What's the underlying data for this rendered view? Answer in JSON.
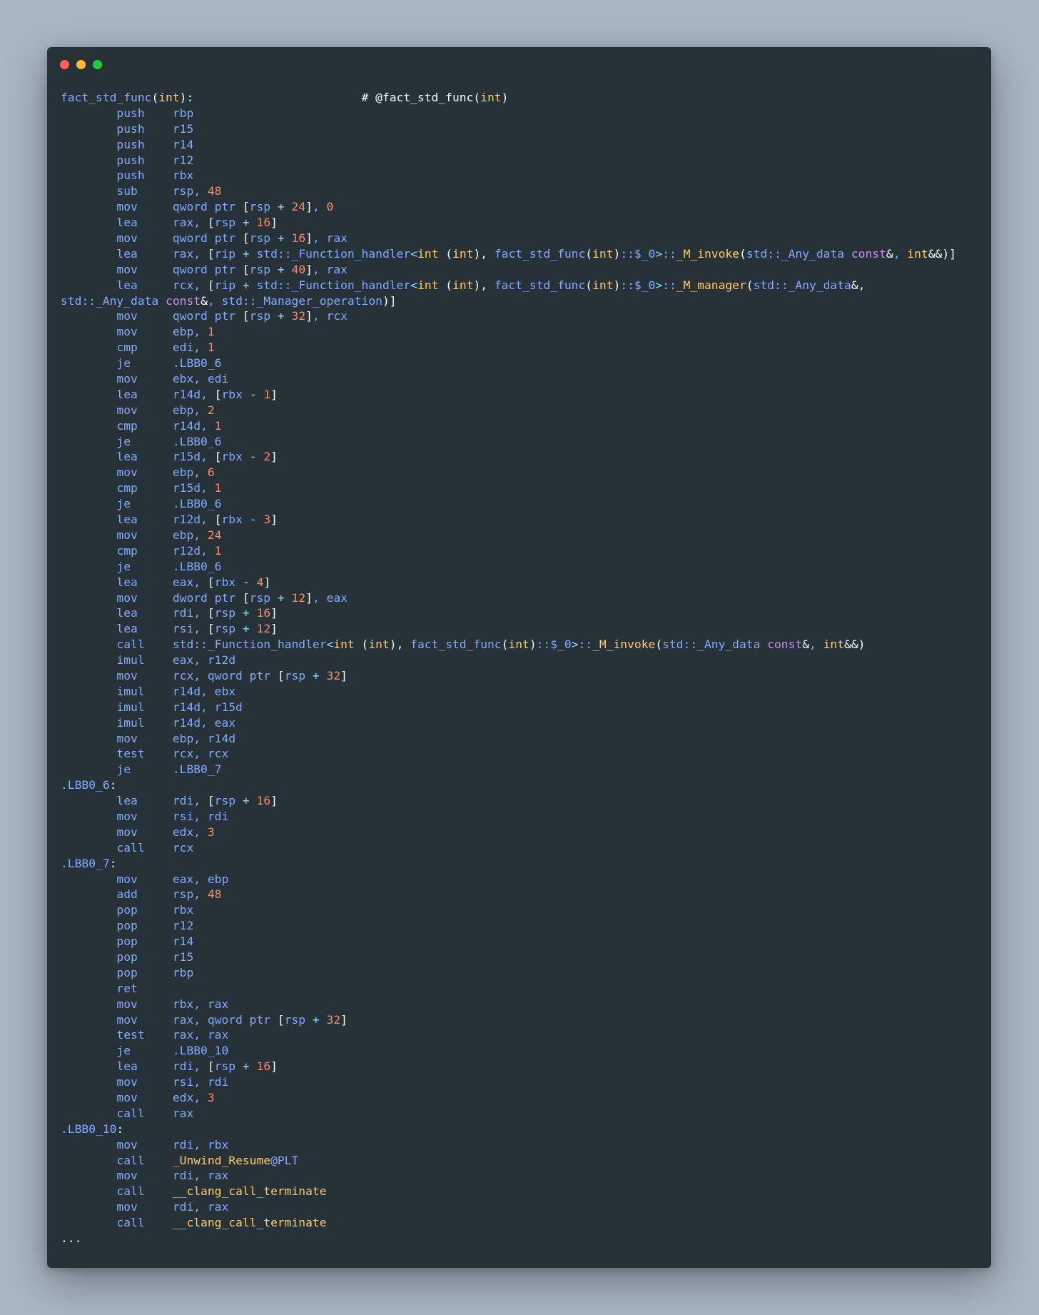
{
  "window": {
    "traffic_lights": [
      {
        "name": "close",
        "color": "#ff5f56"
      },
      {
        "name": "minimize",
        "color": "#ffbd2e"
      },
      {
        "name": "zoom",
        "color": "#27c93f"
      }
    ]
  },
  "code": {
    "lines": [
      [
        [
          "f",
          "fact_std_func"
        ],
        [
          "p",
          "("
        ],
        [
          "k",
          "int"
        ],
        [
          "p",
          "):"
        ],
        [
          "c",
          "                        # @fact_std_func("
        ],
        [
          "k",
          "int"
        ],
        [
          "c",
          ")"
        ]
      ],
      [
        [
          "a",
          "        push    rbp"
        ]
      ],
      [
        [
          "a",
          "        push    r15"
        ]
      ],
      [
        [
          "a",
          "        push    r14"
        ]
      ],
      [
        [
          "a",
          "        push    r12"
        ]
      ],
      [
        [
          "a",
          "        push    rbx"
        ]
      ],
      [
        [
          "a",
          "        sub     rsp, "
        ],
        [
          "n",
          "48"
        ]
      ],
      [
        [
          "a",
          "        mov     qword ptr "
        ],
        [
          "p",
          "["
        ],
        [
          "a",
          "rsp "
        ],
        [
          "o",
          "+"
        ],
        [
          "a",
          " "
        ],
        [
          "n",
          "24"
        ],
        [
          "p",
          "]"
        ],
        [
          "a",
          ", "
        ],
        [
          "n",
          "0"
        ]
      ],
      [
        [
          "a",
          "        lea     rax, "
        ],
        [
          "p",
          "["
        ],
        [
          "a",
          "rsp "
        ],
        [
          "o",
          "+"
        ],
        [
          "a",
          " "
        ],
        [
          "n",
          "16"
        ],
        [
          "p",
          "]"
        ]
      ],
      [
        [
          "a",
          "        mov     qword ptr "
        ],
        [
          "p",
          "["
        ],
        [
          "a",
          "rsp "
        ],
        [
          "o",
          "+"
        ],
        [
          "a",
          " "
        ],
        [
          "n",
          "16"
        ],
        [
          "p",
          "]"
        ],
        [
          "a",
          ", rax"
        ]
      ],
      [
        [
          "a",
          "        lea     rax, "
        ],
        [
          "p",
          "["
        ],
        [
          "a",
          "rip "
        ],
        [
          "o",
          "+"
        ],
        [
          "a",
          " std::_Function_handler"
        ],
        [
          "o",
          "<"
        ],
        [
          "k",
          "int"
        ],
        [
          "a",
          " "
        ],
        [
          "p",
          "("
        ],
        [
          "k",
          "int"
        ],
        [
          "p",
          "),"
        ],
        [
          "a",
          " fact_std_func"
        ],
        [
          "p",
          "("
        ],
        [
          "k",
          "int"
        ],
        [
          "p",
          ")"
        ],
        [
          "a",
          "::$_0"
        ],
        [
          "o",
          ">"
        ],
        [
          "a",
          "::"
        ],
        [
          "k",
          "_M_invoke"
        ],
        [
          "p",
          "("
        ],
        [
          "a",
          "std::_Any_data "
        ],
        [
          "s",
          "const"
        ],
        [
          "p",
          "&"
        ],
        [
          "a",
          ", "
        ],
        [
          "k",
          "int"
        ],
        [
          "p",
          "&&)]"
        ]
      ],
      [
        [
          "a",
          "        mov     qword ptr "
        ],
        [
          "p",
          "["
        ],
        [
          "a",
          "rsp "
        ],
        [
          "o",
          "+"
        ],
        [
          "a",
          " "
        ],
        [
          "n",
          "40"
        ],
        [
          "p",
          "]"
        ],
        [
          "a",
          ", rax"
        ]
      ],
      [
        [
          "a",
          "        lea     rcx, "
        ],
        [
          "p",
          "["
        ],
        [
          "a",
          "rip "
        ],
        [
          "o",
          "+"
        ],
        [
          "a",
          " std::_Function_handler"
        ],
        [
          "o",
          "<"
        ],
        [
          "k",
          "int"
        ],
        [
          "a",
          " "
        ],
        [
          "p",
          "("
        ],
        [
          "k",
          "int"
        ],
        [
          "p",
          "),"
        ],
        [
          "a",
          " fact_std_func"
        ],
        [
          "p",
          "("
        ],
        [
          "k",
          "int"
        ],
        [
          "p",
          ")"
        ],
        [
          "a",
          "::$_0"
        ],
        [
          "o",
          ">"
        ],
        [
          "a",
          "::"
        ],
        [
          "k",
          "_M_manager"
        ],
        [
          "p",
          "("
        ],
        [
          "a",
          "std::_Any_data"
        ],
        [
          "p",
          "&,"
        ]
      ],
      [
        [
          "a",
          "std::_Any_data "
        ],
        [
          "s",
          "const"
        ],
        [
          "p",
          "&"
        ],
        [
          "a",
          ", std::_Manager_operation"
        ],
        [
          "p",
          ")]"
        ]
      ],
      [
        [
          "a",
          "        mov     qword ptr "
        ],
        [
          "p",
          "["
        ],
        [
          "a",
          "rsp "
        ],
        [
          "o",
          "+"
        ],
        [
          "a",
          " "
        ],
        [
          "n",
          "32"
        ],
        [
          "p",
          "]"
        ],
        [
          "a",
          ", rcx"
        ]
      ],
      [
        [
          "a",
          "        mov     ebp, "
        ],
        [
          "n",
          "1"
        ]
      ],
      [
        [
          "a",
          "        cmp     edi, "
        ],
        [
          "n",
          "1"
        ]
      ],
      [
        [
          "a",
          "        je      .LBB0_6"
        ]
      ],
      [
        [
          "a",
          "        mov     ebx, edi"
        ]
      ],
      [
        [
          "a",
          "        lea     r14d, "
        ],
        [
          "p",
          "["
        ],
        [
          "a",
          "rbx "
        ],
        [
          "o",
          "-"
        ],
        [
          "a",
          " "
        ],
        [
          "n",
          "1"
        ],
        [
          "p",
          "]"
        ]
      ],
      [
        [
          "a",
          "        mov     ebp, "
        ],
        [
          "n",
          "2"
        ]
      ],
      [
        [
          "a",
          "        cmp     r14d, "
        ],
        [
          "n",
          "1"
        ]
      ],
      [
        [
          "a",
          "        je      .LBB0_6"
        ]
      ],
      [
        [
          "a",
          "        lea     r15d, "
        ],
        [
          "p",
          "["
        ],
        [
          "a",
          "rbx "
        ],
        [
          "o",
          "-"
        ],
        [
          "a",
          " "
        ],
        [
          "n",
          "2"
        ],
        [
          "p",
          "]"
        ]
      ],
      [
        [
          "a",
          "        mov     ebp, "
        ],
        [
          "n",
          "6"
        ]
      ],
      [
        [
          "a",
          "        cmp     r15d, "
        ],
        [
          "n",
          "1"
        ]
      ],
      [
        [
          "a",
          "        je      .LBB0_6"
        ]
      ],
      [
        [
          "a",
          "        lea     r12d, "
        ],
        [
          "p",
          "["
        ],
        [
          "a",
          "rbx "
        ],
        [
          "o",
          "-"
        ],
        [
          "a",
          " "
        ],
        [
          "n",
          "3"
        ],
        [
          "p",
          "]"
        ]
      ],
      [
        [
          "a",
          "        mov     ebp, "
        ],
        [
          "n",
          "24"
        ]
      ],
      [
        [
          "a",
          "        cmp     r12d, "
        ],
        [
          "n",
          "1"
        ]
      ],
      [
        [
          "a",
          "        je      .LBB0_6"
        ]
      ],
      [
        [
          "a",
          "        lea     eax, "
        ],
        [
          "p",
          "["
        ],
        [
          "a",
          "rbx "
        ],
        [
          "o",
          "-"
        ],
        [
          "a",
          " "
        ],
        [
          "n",
          "4"
        ],
        [
          "p",
          "]"
        ]
      ],
      [
        [
          "a",
          "        mov     dword ptr "
        ],
        [
          "p",
          "["
        ],
        [
          "a",
          "rsp "
        ],
        [
          "o",
          "+"
        ],
        [
          "a",
          " "
        ],
        [
          "n",
          "12"
        ],
        [
          "p",
          "]"
        ],
        [
          "a",
          ", eax"
        ]
      ],
      [
        [
          "a",
          "        lea     rdi, "
        ],
        [
          "p",
          "["
        ],
        [
          "a",
          "rsp "
        ],
        [
          "o",
          "+"
        ],
        [
          "a",
          " "
        ],
        [
          "n",
          "16"
        ],
        [
          "p",
          "]"
        ]
      ],
      [
        [
          "a",
          "        lea     rsi, "
        ],
        [
          "p",
          "["
        ],
        [
          "a",
          "rsp "
        ],
        [
          "o",
          "+"
        ],
        [
          "a",
          " "
        ],
        [
          "n",
          "12"
        ],
        [
          "p",
          "]"
        ]
      ],
      [
        [
          "a",
          "        call    std::_Function_handler"
        ],
        [
          "o",
          "<"
        ],
        [
          "k",
          "int"
        ],
        [
          "a",
          " "
        ],
        [
          "p",
          "("
        ],
        [
          "k",
          "int"
        ],
        [
          "p",
          "),"
        ],
        [
          "a",
          " fact_std_func"
        ],
        [
          "p",
          "("
        ],
        [
          "k",
          "int"
        ],
        [
          "p",
          ")"
        ],
        [
          "a",
          "::$_0"
        ],
        [
          "o",
          ">"
        ],
        [
          "a",
          "::"
        ],
        [
          "k",
          "_M_invoke"
        ],
        [
          "p",
          "("
        ],
        [
          "a",
          "std::_Any_data "
        ],
        [
          "s",
          "const"
        ],
        [
          "p",
          "&"
        ],
        [
          "a",
          ", "
        ],
        [
          "k",
          "int"
        ],
        [
          "p",
          "&&)"
        ]
      ],
      [
        [
          "a",
          "        imul    eax, r12d"
        ]
      ],
      [
        [
          "a",
          "        mov     rcx, qword ptr "
        ],
        [
          "p",
          "["
        ],
        [
          "a",
          "rsp "
        ],
        [
          "o",
          "+"
        ],
        [
          "a",
          " "
        ],
        [
          "n",
          "32"
        ],
        [
          "p",
          "]"
        ]
      ],
      [
        [
          "a",
          "        imul    r14d, ebx"
        ]
      ],
      [
        [
          "a",
          "        imul    r14d, r15d"
        ]
      ],
      [
        [
          "a",
          "        imul    r14d, eax"
        ]
      ],
      [
        [
          "a",
          "        mov     ebp, r14d"
        ]
      ],
      [
        [
          "a",
          "        test    rcx, rcx"
        ]
      ],
      [
        [
          "a",
          "        je      .LBB0_7"
        ]
      ],
      [
        [
          "a",
          ".LBB0_6"
        ],
        [
          "p",
          ":"
        ]
      ],
      [
        [
          "a",
          "        lea     rdi, "
        ],
        [
          "p",
          "["
        ],
        [
          "a",
          "rsp "
        ],
        [
          "o",
          "+"
        ],
        [
          "a",
          " "
        ],
        [
          "n",
          "16"
        ],
        [
          "p",
          "]"
        ]
      ],
      [
        [
          "a",
          "        mov     rsi, rdi"
        ]
      ],
      [
        [
          "a",
          "        mov     edx, "
        ],
        [
          "n",
          "3"
        ]
      ],
      [
        [
          "a",
          "        call    rcx"
        ]
      ],
      [
        [
          "a",
          ".LBB0_7"
        ],
        [
          "p",
          ":"
        ]
      ],
      [
        [
          "a",
          "        mov     eax, ebp"
        ]
      ],
      [
        [
          "a",
          "        add     rsp, "
        ],
        [
          "n",
          "48"
        ]
      ],
      [
        [
          "a",
          "        pop     rbx"
        ]
      ],
      [
        [
          "a",
          "        pop     r12"
        ]
      ],
      [
        [
          "a",
          "        pop     r14"
        ]
      ],
      [
        [
          "a",
          "        pop     r15"
        ]
      ],
      [
        [
          "a",
          "        pop     rbp"
        ]
      ],
      [
        [
          "a",
          "        ret"
        ]
      ],
      [
        [
          "a",
          "        mov     rbx, rax"
        ]
      ],
      [
        [
          "a",
          "        mov     rax, qword ptr "
        ],
        [
          "p",
          "["
        ],
        [
          "a",
          "rsp "
        ],
        [
          "o",
          "+"
        ],
        [
          "a",
          " "
        ],
        [
          "n",
          "32"
        ],
        [
          "p",
          "]"
        ]
      ],
      [
        [
          "a",
          "        test    rax, rax"
        ]
      ],
      [
        [
          "a",
          "        je      .LBB0_10"
        ]
      ],
      [
        [
          "a",
          "        lea     rdi, "
        ],
        [
          "p",
          "["
        ],
        [
          "a",
          "rsp "
        ],
        [
          "o",
          "+"
        ],
        [
          "a",
          " "
        ],
        [
          "n",
          "16"
        ],
        [
          "p",
          "]"
        ]
      ],
      [
        [
          "a",
          "        mov     rsi, rdi"
        ]
      ],
      [
        [
          "a",
          "        mov     edx, "
        ],
        [
          "n",
          "3"
        ]
      ],
      [
        [
          "a",
          "        call    rax"
        ]
      ],
      [
        [
          "a",
          ".LBB0_10"
        ],
        [
          "p",
          ":"
        ]
      ],
      [
        [
          "a",
          "        mov     rdi, rbx"
        ]
      ],
      [
        [
          "a",
          "        call    "
        ],
        [
          "k",
          "_Unwind_Resume"
        ],
        [
          "a",
          "@PLT"
        ]
      ],
      [
        [
          "a",
          "        mov     rdi, rax"
        ]
      ],
      [
        [
          "a",
          "        call    "
        ],
        [
          "k",
          "__clang_call_terminate"
        ]
      ],
      [
        [
          "a",
          "        mov     rdi, rax"
        ]
      ],
      [
        [
          "a",
          "        call    "
        ],
        [
          "k",
          "__clang_call_terminate"
        ]
      ],
      [
        [
          "p",
          "..."
        ]
      ]
    ]
  },
  "colors": {
    "background": "#a8b7c4",
    "window": "#263238",
    "default_text": "#82aaff",
    "number": "#f78c6c",
    "type_keyword": "#ffcb6b",
    "punctuation": "#eeffff",
    "operator": "#89ddff",
    "const_keyword": "#c792ea"
  }
}
